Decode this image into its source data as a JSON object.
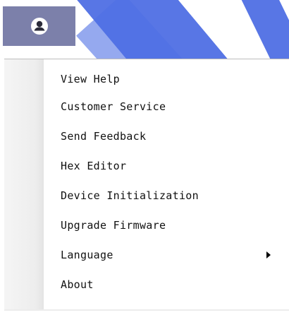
{
  "header": {
    "avatar_icon": "user-avatar-icon",
    "avatar_bg": "#7c80aa"
  },
  "menu": {
    "items": [
      {
        "label": "View Help"
      },
      {
        "label": "Customer Service"
      },
      {
        "label": "Send Feedback"
      },
      {
        "label": "Hex Editor"
      },
      {
        "label": "Device Initialization"
      },
      {
        "label": "Upgrade Firmware"
      },
      {
        "label": "Language",
        "submenu_icon": "chevron-right-icon"
      },
      {
        "label": "About"
      }
    ]
  },
  "colors": {
    "background_accent": "#4f6fe4",
    "menu_text": "#111111"
  }
}
